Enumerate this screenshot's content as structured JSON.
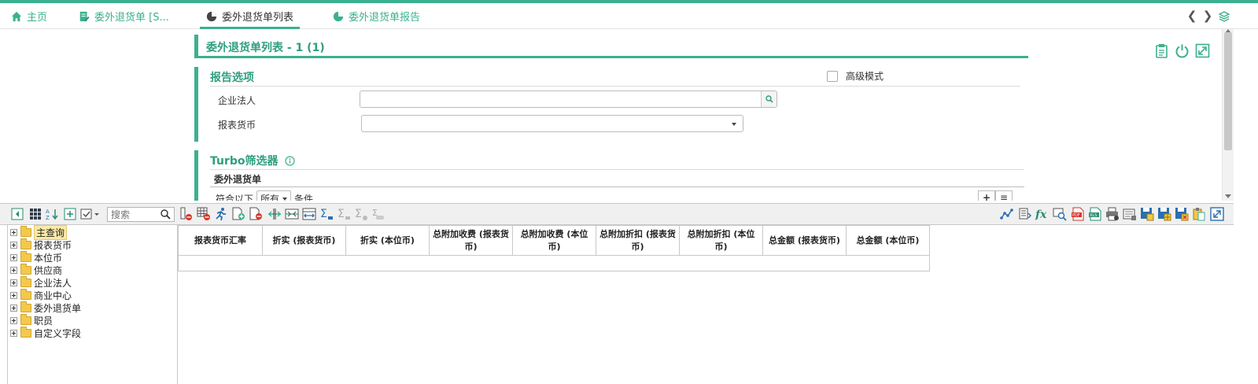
{
  "tabs": [
    {
      "label": "主页",
      "icon": "home-icon",
      "active": false
    },
    {
      "label": "委外退货单 [S...",
      "icon": "document-edit-icon",
      "active": false
    },
    {
      "label": "委外退货单列表",
      "icon": "pie-chart-icon",
      "active": true
    },
    {
      "label": "委外退货单报告",
      "icon": "pie-chart-icon",
      "active": false
    }
  ],
  "page": {
    "title": "委外退货单列表 - 1 (1)"
  },
  "report_options": {
    "title": "报告选项",
    "advanced_mode_label": "高级模式",
    "advanced_mode_checked": false,
    "fields": [
      {
        "label": "企业法人",
        "value": ""
      },
      {
        "label": "报表货币",
        "value": ""
      }
    ]
  },
  "turbo": {
    "title": "Turbo筛选器",
    "subtitle": "委外退货单",
    "match_prefix": "符合以下",
    "match_value": "所有",
    "match_suffix": "条件"
  },
  "toolbar": {
    "search_placeholder": "搜索"
  },
  "tree": [
    {
      "label": "主查询",
      "selected": true
    },
    {
      "label": "报表货币",
      "selected": false
    },
    {
      "label": "本位币",
      "selected": false
    },
    {
      "label": "供应商",
      "selected": false
    },
    {
      "label": "企业法人",
      "selected": false
    },
    {
      "label": "商业中心",
      "selected": false
    },
    {
      "label": "委外退货单",
      "selected": false
    },
    {
      "label": "职员",
      "selected": false
    },
    {
      "label": "自定义字段",
      "selected": false
    }
  ],
  "grid": {
    "columns": [
      [
        "报表货币汇率"
      ],
      [
        "折实 (报表货币)"
      ],
      [
        "折实 (本位币)"
      ],
      [
        "总附加收费 (报表货",
        "币)"
      ],
      [
        "总附加收费 (本位",
        "币)"
      ],
      [
        "总附加折扣 (报表货",
        "币)"
      ],
      [
        "总附加折扣 (本位",
        "币)"
      ],
      [
        "总金额 (报表货币)"
      ],
      [
        "总金额 (本位币)"
      ]
    ]
  },
  "colors": {
    "accent": "#3bb08f",
    "title_green": "#2f9e7f"
  }
}
